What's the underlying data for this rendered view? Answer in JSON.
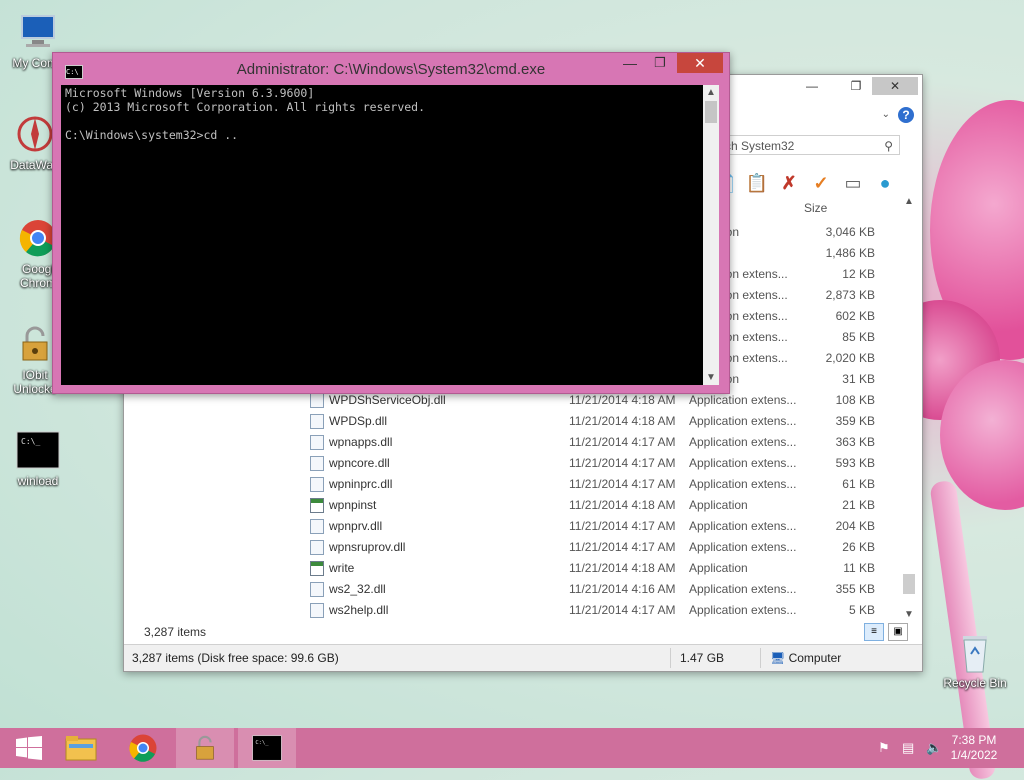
{
  "desktop": {
    "icons": [
      {
        "label": "My Comp",
        "icon": "computer-icon"
      },
      {
        "label": "DataWag",
        "icon": "datawag-icon"
      },
      {
        "label": "Googl Chrom",
        "icon": "chrome-icon"
      },
      {
        "label": "IObit Unlocke",
        "icon": "iobit-unlocker-icon"
      },
      {
        "label": "winload",
        "icon": "cmd-shortcut-icon"
      },
      {
        "label": "Recycle Bin",
        "icon": "recycle-bin-icon"
      }
    ]
  },
  "cmd": {
    "title": "Administrator: C:\\Windows\\System32\\cmd.exe",
    "icon_text": "C:\\",
    "lines": [
      "Microsoft Windows [Version 6.3.9600]",
      "(c) 2013 Microsoft Corporation. All rights reserved.",
      "",
      "C:\\Windows\\system32>cd .."
    ]
  },
  "explorer": {
    "search_placeholder": "rch System32",
    "column_size": "Size",
    "partial_rows": [
      {
        "type": "ation",
        "size": "3,046 KB"
      },
      {
        "type": "",
        "size": "1,486 KB"
      },
      {
        "type": "ation extens...",
        "size": "12 KB"
      },
      {
        "type": "ation extens...",
        "size": "2,873 KB"
      },
      {
        "type": "ation extens...",
        "size": "602 KB"
      },
      {
        "type": "ation extens...",
        "size": "85 KB"
      },
      {
        "type": "ation extens...",
        "size": "2,020 KB"
      },
      {
        "type": "ation",
        "size": "31 KB"
      }
    ],
    "rows": [
      {
        "name": "WPDShServiceObj.dll",
        "date": "11/21/2014 4:18 AM",
        "type": "Application extens...",
        "size": "108 KB",
        "kind": "dll"
      },
      {
        "name": "WPDSp.dll",
        "date": "11/21/2014 4:18 AM",
        "type": "Application extens...",
        "size": "359 KB",
        "kind": "dll"
      },
      {
        "name": "wpnapps.dll",
        "date": "11/21/2014 4:17 AM",
        "type": "Application extens...",
        "size": "363 KB",
        "kind": "dll"
      },
      {
        "name": "wpncore.dll",
        "date": "11/21/2014 4:17 AM",
        "type": "Application extens...",
        "size": "593 KB",
        "kind": "dll"
      },
      {
        "name": "wpninprc.dll",
        "date": "11/21/2014 4:17 AM",
        "type": "Application extens...",
        "size": "61 KB",
        "kind": "dll"
      },
      {
        "name": "wpnpinst",
        "date": "11/21/2014 4:18 AM",
        "type": "Application",
        "size": "21 KB",
        "kind": "exe"
      },
      {
        "name": "wpnprv.dll",
        "date": "11/21/2014 4:17 AM",
        "type": "Application extens...",
        "size": "204 KB",
        "kind": "dll"
      },
      {
        "name": "wpnsruprov.dll",
        "date": "11/21/2014 4:17 AM",
        "type": "Application extens...",
        "size": "26 KB",
        "kind": "dll"
      },
      {
        "name": "write",
        "date": "11/21/2014 4:18 AM",
        "type": "Application",
        "size": "11 KB",
        "kind": "exe"
      },
      {
        "name": "ws2_32.dll",
        "date": "11/21/2014 4:16 AM",
        "type": "Application extens...",
        "size": "355 KB",
        "kind": "dll"
      },
      {
        "name": "ws2help.dll",
        "date": "11/21/2014 4:17 AM",
        "type": "Application extens...",
        "size": "5 KB",
        "kind": "dll"
      }
    ],
    "item_count": "3,287 items",
    "status_left": "3,287 items (Disk free space: 99.6 GB)",
    "status_size": "1.47 GB",
    "status_location": "Computer"
  },
  "taskbar": {
    "clock_time": "7:38 PM",
    "clock_date": "1/4/2022",
    "items": [
      "start-icon",
      "file-explorer-icon",
      "chrome-icon",
      "iobit-unlocker-icon",
      "cmd-icon"
    ]
  }
}
